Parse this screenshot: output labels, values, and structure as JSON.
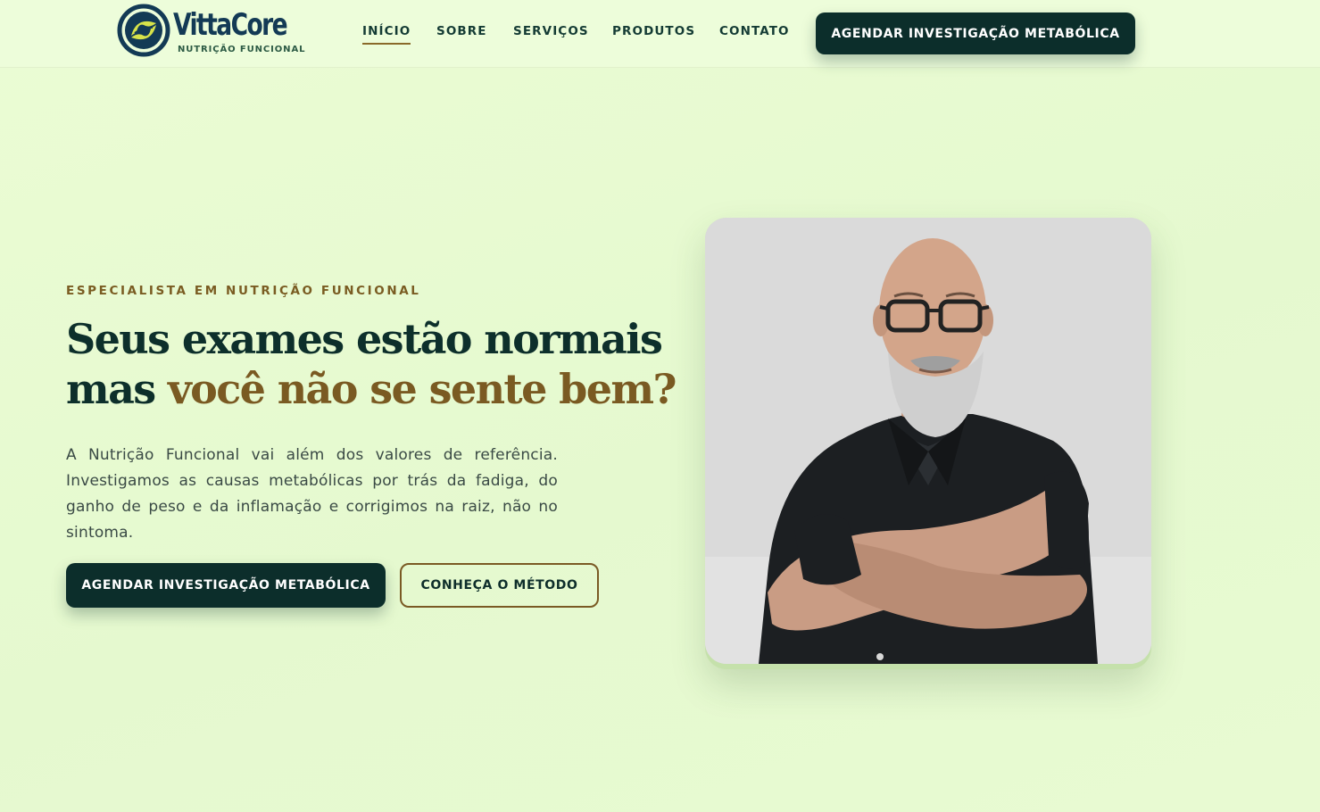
{
  "brand": {
    "name": "VittaCore",
    "tagline": "NUTRIÇÃO FUNCIONAL",
    "colors": {
      "dark": "#0c2e2b",
      "gold": "#7a5a22",
      "background": "#e9fbd2",
      "logo_blue": "#133a55",
      "logo_yellow": "#d7e34a"
    }
  },
  "nav": {
    "items": [
      {
        "label": "INÍCIO",
        "active": true
      },
      {
        "label": "SOBRE",
        "active": false
      },
      {
        "label": "SERVIÇOS",
        "active": false
      },
      {
        "label": "PRODUTOS",
        "active": false
      },
      {
        "label": "CONTATO",
        "active": false
      }
    ],
    "cta_label": "AGENDAR INVESTIGAÇÃO METABÓLICA"
  },
  "hero": {
    "eyebrow": "ESPECIALISTA EM NUTRIÇÃO FUNCIONAL",
    "headline_line1": "Seus exames estão normais",
    "headline_line2_plain": "mas ",
    "headline_line2_accent": "você não se sente bem?",
    "intro": "A Nutrição Funcional vai além dos valores de referência. Investigamos as causas metabólicas por trás da fadiga, do ganho de peso e da inflamação e corrigimos na raiz, não no sintoma.",
    "primary_cta": "AGENDAR INVESTIGAÇÃO METABÓLICA",
    "secondary_cta": "CONHEÇA O MÉTODO",
    "photo_icon": "portrait-photo"
  }
}
